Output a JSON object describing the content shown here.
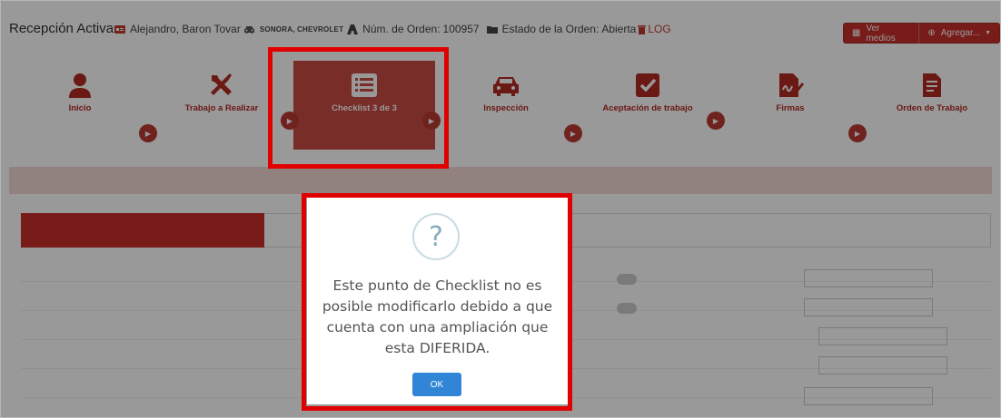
{
  "header": {
    "title": "Recepción Activa",
    "client": "Alejandro, Baron Tovar",
    "vehicle": "SONORA, CHEVROLET",
    "order_label": "Núm. de Orden:",
    "order_number": "100957",
    "status_label": "Estado de la Orden:",
    "status_value": "Abierta",
    "log": "LOG"
  },
  "actions": {
    "ver_medios": "Ver medios",
    "agregar": "Agregar..."
  },
  "steps": [
    {
      "label": "Inicio",
      "icon": "user-icon"
    },
    {
      "label": "Trabajo a Realizar",
      "icon": "tools-icon"
    },
    {
      "label": "Checklist 3 de 3",
      "icon": "list-icon"
    },
    {
      "label": "Inspección",
      "icon": "car-icon"
    },
    {
      "label": "Aceptación de trabajo",
      "icon": "check-square-icon"
    },
    {
      "label": "Firmas",
      "icon": "signature-icon"
    },
    {
      "label": "Orden de Trabajo",
      "icon": "document-icon"
    }
  ],
  "modal": {
    "message": "Este punto de Checklist no es posible modificarlo debido a que cuenta con una ampliación que esta DIFERIDA.",
    "ok": "OK"
  },
  "colors": {
    "brand_red": "#c9302c",
    "highlight": "#e00000",
    "ok_blue": "#3085d6"
  }
}
